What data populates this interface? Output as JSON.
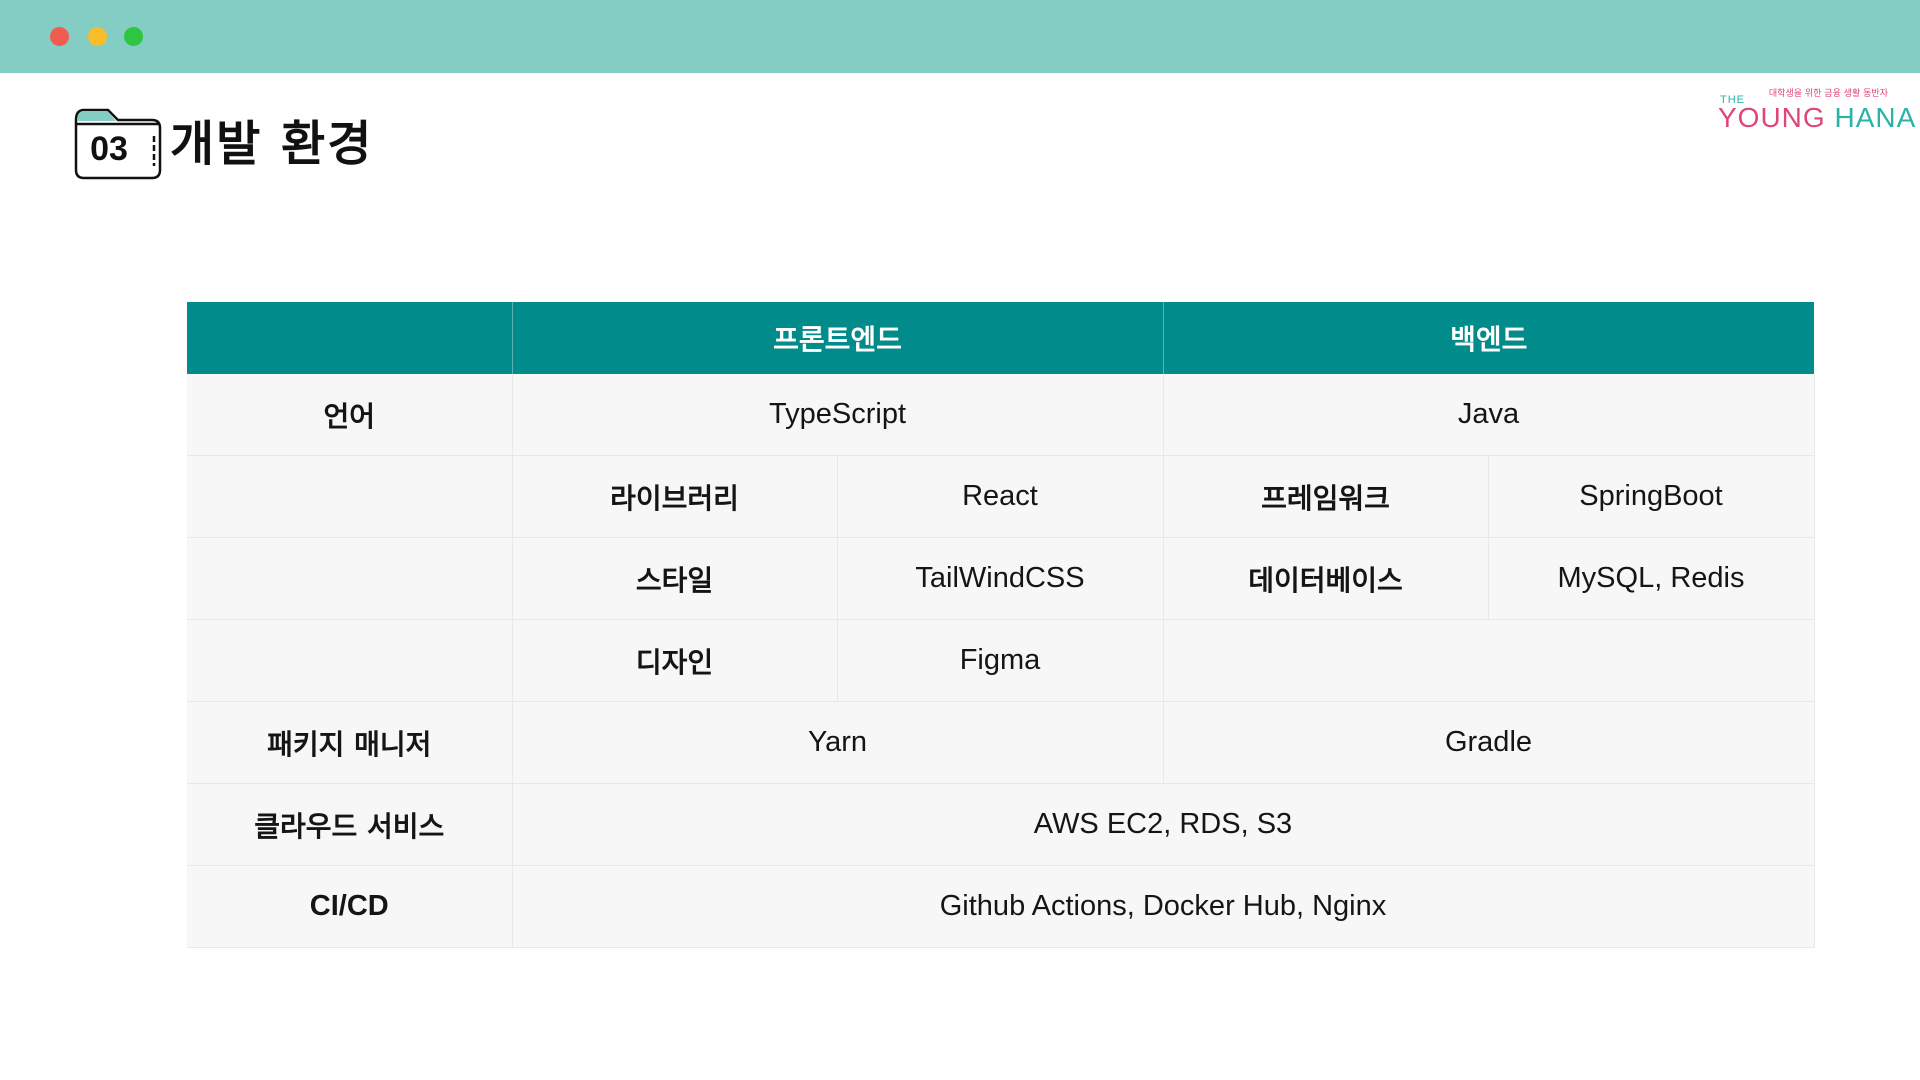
{
  "window": {
    "controls": [
      "close",
      "minimize",
      "maximize"
    ],
    "colors": {
      "bar": "#84cdc4",
      "close": "#f25b50",
      "minimize": "#f7bd2b",
      "maximize": "#2dc63f"
    }
  },
  "heading": {
    "section_number": "03",
    "title": "개발 환경",
    "icon": "folder-icon"
  },
  "logo": {
    "tagline": "대학생을 위한 금융 생활 동반자",
    "the": "THE",
    "name_part1": "YOUNG",
    "name_part2": "HANA",
    "colors": {
      "pink": "#e0457b",
      "teal": "#2ab3a6"
    }
  },
  "table": {
    "header": {
      "corner": "",
      "frontend": "프론트엔드",
      "backend": "백엔드"
    },
    "rows": {
      "language": {
        "label": "언어",
        "frontend": "TypeScript",
        "backend": "Java"
      },
      "library": {
        "fe_key": "라이브러리",
        "fe_value": "React",
        "be_key": "프레임워크",
        "be_value": "SpringBoot"
      },
      "style": {
        "fe_key": "스타일",
        "fe_value": "TailWindCSS",
        "be_key": "데이터베이스",
        "be_value": "MySQL, Redis"
      },
      "design": {
        "fe_key": "디자인",
        "fe_value": "Figma"
      },
      "package_manager": {
        "label": "패키지 매니저",
        "frontend": "Yarn",
        "backend": "Gradle"
      },
      "cloud": {
        "label": "클라우드 서비스",
        "value": "AWS EC2, RDS, S3"
      },
      "cicd": {
        "label": "CI/CD",
        "value": "Github Actions, Docker Hub, Nginx"
      }
    },
    "colors": {
      "header": "#018b8a",
      "cell": "#f6f7f6"
    }
  }
}
